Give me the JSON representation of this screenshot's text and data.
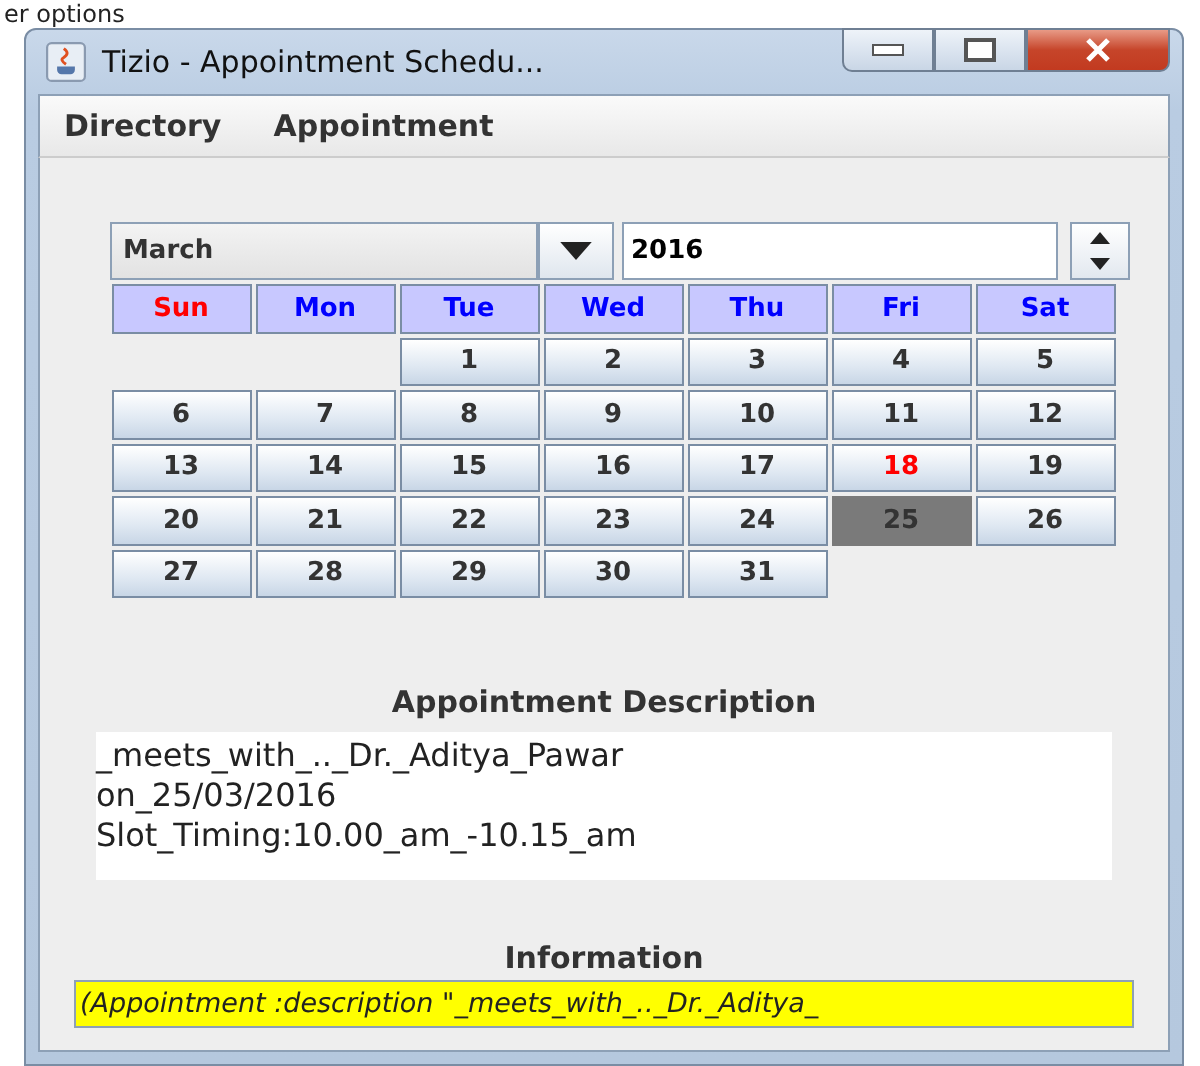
{
  "caption": "er  options",
  "window": {
    "title": "Tizio - Appointment Schedu..."
  },
  "menu": [
    "Directory",
    "Appointment"
  ],
  "calendar": {
    "month": "March",
    "year": "2016",
    "weekdays": [
      {
        "label": "Sun",
        "color": "#ff0000"
      },
      {
        "label": "Mon",
        "color": "#0000ff"
      },
      {
        "label": "Tue",
        "color": "#0000ff"
      },
      {
        "label": "Wed",
        "color": "#0000ff"
      },
      {
        "label": "Thu",
        "color": "#0000ff"
      },
      {
        "label": "Fri",
        "color": "#0000ff"
      },
      {
        "label": "Sat",
        "color": "#0000ff"
      }
    ],
    "weeks": [
      [
        {
          "kind": "blank"
        },
        {
          "kind": "blank"
        },
        {
          "day": "1",
          "selected": false,
          "today": false
        },
        {
          "day": "2",
          "selected": false,
          "today": false
        },
        {
          "day": "3",
          "selected": false,
          "today": false
        },
        {
          "day": "4",
          "selected": false,
          "today": false
        },
        {
          "day": "5",
          "selected": false,
          "today": false
        }
      ],
      [
        {
          "day": "6",
          "selected": false,
          "today": false
        },
        {
          "day": "7",
          "selected": false,
          "today": false
        },
        {
          "day": "8",
          "selected": false,
          "today": false
        },
        {
          "day": "9",
          "selected": false,
          "today": false
        },
        {
          "day": "10",
          "selected": false,
          "today": false
        },
        {
          "day": "11",
          "selected": false,
          "today": false
        },
        {
          "day": "12",
          "selected": false,
          "today": false
        }
      ],
      [
        {
          "day": "13",
          "selected": false,
          "today": false
        },
        {
          "day": "14",
          "selected": false,
          "today": false
        },
        {
          "day": "15",
          "selected": false,
          "today": false
        },
        {
          "day": "16",
          "selected": false,
          "today": false
        },
        {
          "day": "17",
          "selected": false,
          "today": false
        },
        {
          "day": "18",
          "selected": false,
          "today": true
        },
        {
          "day": "19",
          "selected": false,
          "today": false
        }
      ],
      [
        {
          "day": "20",
          "selected": false,
          "today": false
        },
        {
          "day": "21",
          "selected": false,
          "today": false
        },
        {
          "day": "22",
          "selected": false,
          "today": false
        },
        {
          "day": "23",
          "selected": false,
          "today": false
        },
        {
          "day": "24",
          "selected": false,
          "today": false
        },
        {
          "day": "25",
          "selected": true,
          "today": false
        },
        {
          "day": "26",
          "selected": false,
          "today": false
        }
      ],
      [
        {
          "day": "27",
          "selected": false,
          "today": false
        },
        {
          "day": "28",
          "selected": false,
          "today": false
        },
        {
          "day": "29",
          "selected": false,
          "today": false
        },
        {
          "day": "30",
          "selected": false,
          "today": false
        },
        {
          "day": "31",
          "selected": false,
          "today": false
        }
      ]
    ]
  },
  "description": {
    "title": "Appointment Description",
    "lines": [
      "_meets_with_.._Dr._Aditya_Pawar",
      "on_25/03/2016",
      "Slot_Timing:10.00_am_-10.15_am"
    ]
  },
  "information": {
    "title": "Information",
    "value": "(Appointment :description \"_meets_with_.._Dr._Aditya_"
  }
}
